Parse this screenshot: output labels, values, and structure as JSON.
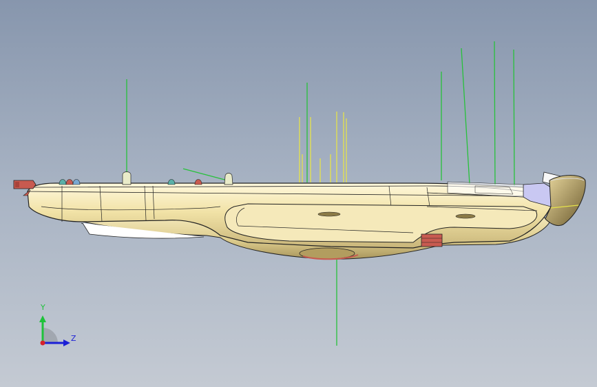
{
  "view": {
    "background_top": "#8796ad",
    "background_bottom": "#c4cad3"
  },
  "model": {
    "body_color": "#f1e4b0",
    "edge_color": "#222222",
    "highlight_color": "#fbf5d9",
    "accent_red": "#c85a50",
    "accent_blue": "#c9c8f2",
    "reference_green": "#27c13a",
    "reference_yellow": "#e6e34a"
  },
  "triad": {
    "y_label": "Y",
    "z_label": "Z",
    "y_color": "#1ec23a",
    "z_color": "#1b1fd6",
    "origin_color": "#d6222a"
  }
}
